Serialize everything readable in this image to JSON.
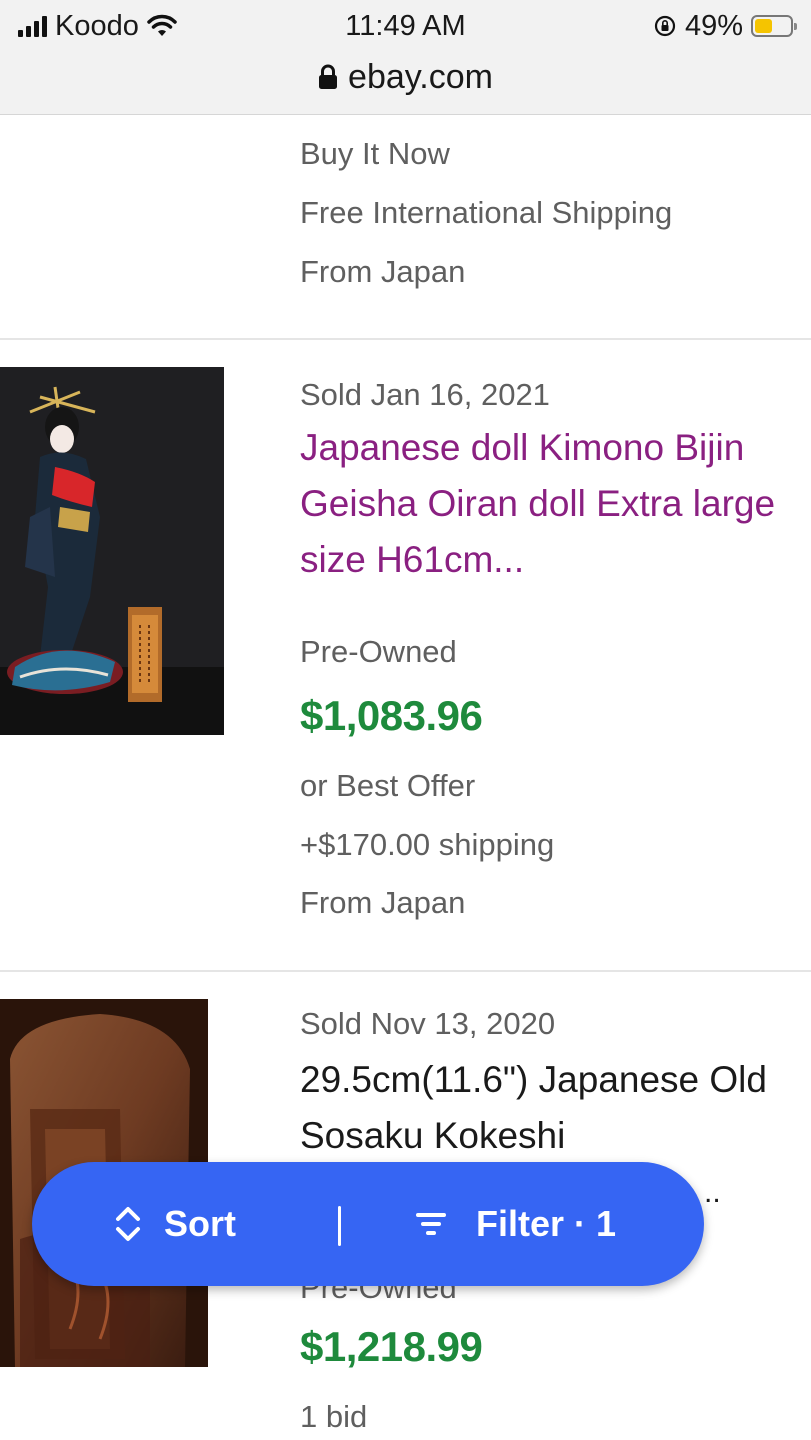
{
  "status_bar": {
    "carrier": "Koodo",
    "time": "11:49 AM",
    "battery_percent": "49%",
    "battery_level": 0.49,
    "battery_color": "#f5c400"
  },
  "url_bar": {
    "domain": "ebay.com",
    "lock_icon": "lock-icon"
  },
  "listings": [
    {
      "lines": [
        "Buy It Now",
        "Free International Shipping",
        "From Japan"
      ]
    },
    {
      "sold_date": "Sold Jan 16, 2021",
      "title": "Japanese doll Kimono Bijin Geisha Oiran doll Extra large size H61cm...",
      "condition": "Pre-Owned",
      "price": "$1,083.96",
      "offer": "or Best Offer",
      "shipping": "+$170.00 shipping",
      "origin": "From Japan",
      "title_color": "#8a2081"
    },
    {
      "sold_date": "Sold Nov 13, 2020",
      "title": "29.5cm(11.6\") Japanese Old Sosaku Kokeshi",
      "title_overflow": "..",
      "condition_partial": "Pre-Owned",
      "price": "$1,218.99",
      "bids": "1 bid"
    }
  ],
  "sort_filter": {
    "sort_label": "Sort",
    "filter_label": "Filter",
    "filter_count": "· 1",
    "pill_color": "#3665f3"
  },
  "colors": {
    "price_green": "#1e8a3c",
    "visited_title_purple": "#8a2081",
    "meta_gray": "#5f5f5f"
  }
}
